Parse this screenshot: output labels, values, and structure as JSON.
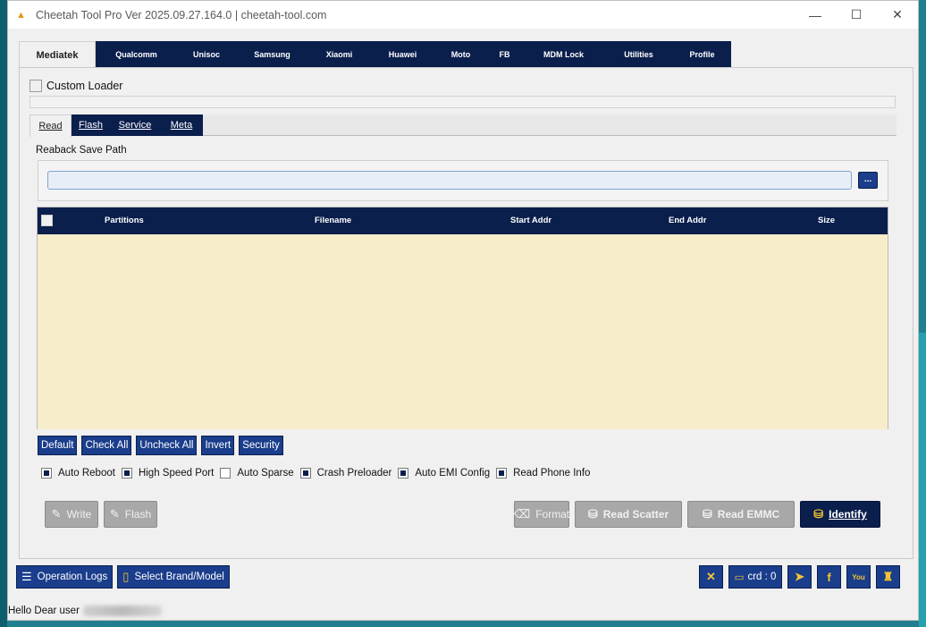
{
  "window": {
    "title": "Cheetah Tool Pro Ver 2025.09.27.164.0 | cheetah-tool.com",
    "app_icon": "cheetah-logo-icon",
    "minimize": "—",
    "maximize": "☐",
    "close": "✕"
  },
  "main_tabs": [
    {
      "label": "Mediatek",
      "active": true
    },
    {
      "label": "Qualcomm"
    },
    {
      "label": "Unisoc"
    },
    {
      "label": "Samsung"
    },
    {
      "label": "Xiaomi"
    },
    {
      "label": "Huawei"
    },
    {
      "label": "Moto"
    },
    {
      "label": "FB"
    },
    {
      "label": "MDM Lock"
    },
    {
      "label": "Utilities"
    },
    {
      "label": "Profile"
    }
  ],
  "custom_loader": {
    "label": "Custom Loader",
    "checked": false
  },
  "sub_tabs": [
    {
      "label": "Read",
      "active": true
    },
    {
      "label": "Flash"
    },
    {
      "label": "Service"
    },
    {
      "label": "Meta"
    }
  ],
  "readback": {
    "label": "Reaback Save Path",
    "value": "",
    "browse_label": "..."
  },
  "table": {
    "columns": [
      "Partitions",
      "Filename",
      "Start Addr",
      "End Addr",
      "Size"
    ],
    "rows": []
  },
  "table_buttons": [
    "Default",
    "Check All",
    "Uncheck All",
    "Invert",
    "Security"
  ],
  "options": [
    {
      "label": "Auto Reboot",
      "checked": true
    },
    {
      "label": "High Speed Port",
      "checked": true
    },
    {
      "label": "Auto Sparse",
      "checked": false
    },
    {
      "label": "Crash Preloader",
      "checked": true
    },
    {
      "label": "Auto EMI Config",
      "checked": true
    },
    {
      "label": "Read Phone Info",
      "checked": true
    }
  ],
  "actions": {
    "write": "Write",
    "flash": "Flash",
    "format": "Format",
    "read_scatter": "Read Scatter",
    "read_emmc": "Read EMMC",
    "identify": "Identify"
  },
  "bottom": {
    "operation_logs": "Operation Logs",
    "select_brand": "Select Brand/Model",
    "credits": "crd : 0"
  },
  "status": {
    "greeting": "Hello Dear user"
  },
  "colors": {
    "navy": "#0b1f4d",
    "button_blue": "#1a3d8c",
    "table_bg": "#f7edcb",
    "icon_gold": "#f7c531"
  }
}
